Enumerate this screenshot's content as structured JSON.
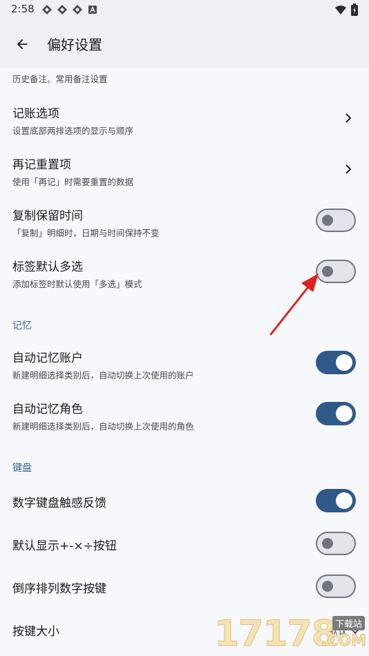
{
  "status_bar": {
    "time": "2:58"
  },
  "appbar": {
    "title": "偏好设置"
  },
  "items": [
    {
      "subtitle": "历史备注、常用备注设置",
      "control": "chevron"
    },
    {
      "title": "记账选项",
      "subtitle": "设置底部两排选项的显示与顺序",
      "control": "chevron"
    },
    {
      "title": "再记重置项",
      "subtitle": "使用「再记」时需要重置的数据",
      "control": "chevron"
    },
    {
      "title": "复制保留时间",
      "subtitle": "「复制」明细时，日期与时间保持不变",
      "control": "switch",
      "on": false
    },
    {
      "title": "标签默认多选",
      "subtitle": "添加标签时默认使用「多选」模式",
      "control": "switch",
      "on": false
    }
  ],
  "section_memory": {
    "label": "记忆"
  },
  "memory_items": [
    {
      "title": "自动记忆账户",
      "subtitle": "新建明细选择类别后，自动切换上次使用的账户",
      "control": "switch",
      "on": true
    },
    {
      "title": "自动记忆角色",
      "subtitle": "新建明细选择类别后，自动切换上次使用的角色",
      "control": "switch",
      "on": true
    }
  ],
  "section_keyboard": {
    "label": "键盘"
  },
  "keyboard_items": [
    {
      "title": "数字键盘触感反馈",
      "control": "switch",
      "on": true
    },
    {
      "title": "默认显示+-×÷按钮",
      "control": "switch",
      "on": false
    },
    {
      "title": "倒序排列数字按键",
      "control": "switch",
      "on": false
    },
    {
      "title": "按键大小",
      "value": "默认",
      "control": "dropdown"
    }
  ],
  "watermark": {
    "text": "17178",
    "badge": "下载站",
    "suffix": ".COM"
  },
  "colors": {
    "accent": "#30598a",
    "switch_off": "#72757e",
    "annotation_arrow": "#e0201f"
  }
}
